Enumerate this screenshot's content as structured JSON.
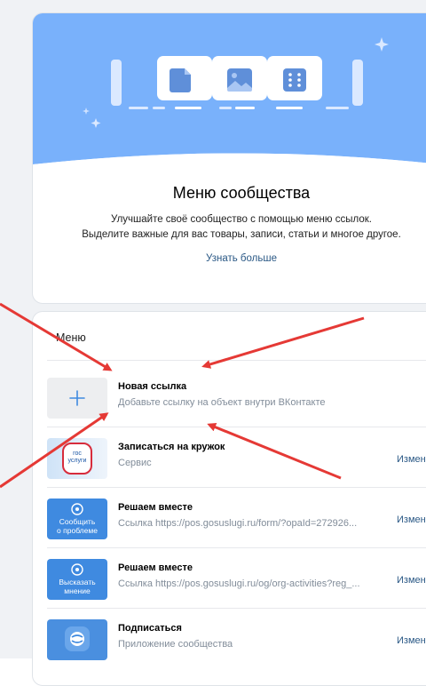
{
  "intro": {
    "title": "Меню сообщества",
    "desc_line1": "Улучшайте своё сообщество с помощью меню ссылок.",
    "desc_line2": "Выделите важные для вас товары, записи, статьи и многое другое.",
    "learn_more": "Узнать больше"
  },
  "menu": {
    "heading": "Меню",
    "new_link": {
      "title": "Новая ссылка",
      "subtitle": "Добавьте ссылку на объект внутри ВКонтакте"
    },
    "items": [
      {
        "title": "Записаться на кружок",
        "subtitle": "Сервис",
        "edit_label": "Изменить",
        "thumb_logo_line1": "гос",
        "thumb_logo_line2": "услуги"
      },
      {
        "title": "Решаем вместе",
        "subtitle": "Ссылка https://pos.gosuslugi.ru/form/?opaId=272926...",
        "edit_label": "Изменить",
        "thumb_line1": "Сообщить",
        "thumb_line2": "о проблеме"
      },
      {
        "title": "Решаем вместе",
        "subtitle": "Ссылка https://pos.gosuslugi.ru/og/org-activities?reg_...",
        "edit_label": "Изменить",
        "thumb_line1": "Высказать",
        "thumb_line2": "мнение"
      },
      {
        "title": "Подписаться",
        "subtitle": "Приложение сообщества",
        "edit_label": "Изменить"
      }
    ]
  },
  "colors": {
    "hero_blue": "#79b1fb",
    "link_blue": "#2a5885",
    "thumb_blue": "#3f8ae0",
    "arrow_red": "#e53935"
  }
}
